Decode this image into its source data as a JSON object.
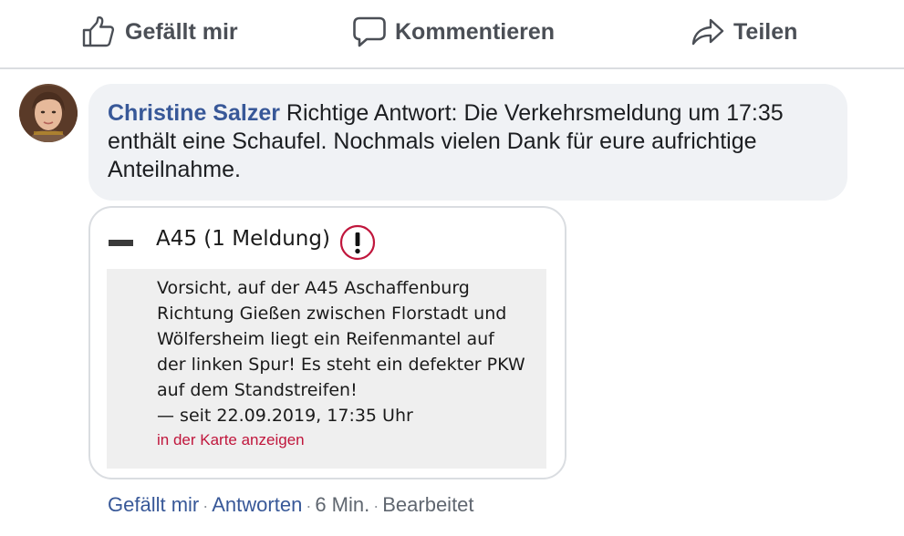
{
  "actions": {
    "like_label": "Gefällt mir",
    "comment_label": "Kommentieren",
    "share_label": "Teilen"
  },
  "comment": {
    "author": "Christine Salzer",
    "text": "Richtige Antwort: Die Verkehrsmeldung um 17:35 enthält eine Schaufel. Nochmals vielen Dank für eure aufrichtige Anteilnahme.",
    "attachment": {
      "road_title": "A45 (1 Meldung)",
      "message": "Vorsicht, auf der A45 Aschaffenburg\nRichtung Gießen zwischen Florstadt und\nWölfersheim liegt ein Reifenmantel auf\nder linken Spur! Es steht ein defekter PKW\nauf dem Standstreifen!",
      "since": "— seit 22.09.2019, 17:35 Uhr",
      "map_link": "in der Karte anzeigen",
      "warning_icon": "exclamation-circle-icon",
      "warning_color": "#c0163c"
    },
    "meta": {
      "like": "Gefällt mir",
      "reply": "Antworten",
      "time": "6 Min.",
      "edited": "Bearbeitet",
      "separator": "·"
    }
  },
  "colors": {
    "link": "#385898",
    "action_text": "#4b4f56",
    "bubble": "#f0f2f5",
    "meta_text": "#606770"
  }
}
